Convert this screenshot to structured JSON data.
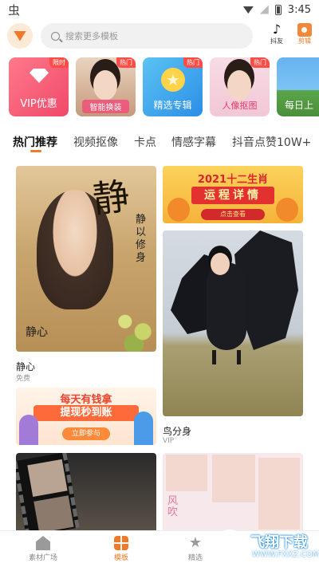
{
  "status_bar": {
    "time": "3:45",
    "left_icon": "bug-icon"
  },
  "search": {
    "placeholder": "搜索更多模板"
  },
  "top_actions": {
    "tiktok_label": "抖友",
    "cut_label": "剪辑"
  },
  "tiles": [
    {
      "label": "VIP优惠",
      "badge": "限时"
    },
    {
      "label": "智能换装",
      "badge": "热门"
    },
    {
      "label": "精选专辑",
      "badge": "热门"
    },
    {
      "label": "人像抠图",
      "badge": "热门"
    },
    {
      "label": "每日上"
    }
  ],
  "tabs": [
    "热门推荐",
    "视频抠像",
    "卡点",
    "情感字幕",
    "抖音点赞10W+"
  ],
  "feed": {
    "jingxin": {
      "title": "静心",
      "subtitle": "免费",
      "calligraphy": "静",
      "poem": "静以修身",
      "signature": "静心"
    },
    "zodiac": {
      "headline": "2021十二生肖",
      "banner": "运程详情",
      "sub": "点击查看"
    },
    "bird": {
      "title": "鸟分身",
      "subtitle": "VIP"
    },
    "ad": {
      "line1": "每天有钱拿",
      "line2": "提现秒到账",
      "button": "立即参与"
    },
    "collage": {
      "text": "风吹"
    }
  },
  "bottom_nav": [
    {
      "label": "素材广场",
      "icon": "home-icon"
    },
    {
      "label": "模板",
      "icon": "template-grid-icon",
      "active": true
    },
    {
      "label": "精选",
      "icon": "star-icon"
    }
  ],
  "watermark": {
    "title": "飞翔下载",
    "url": "WWW.FXXZ.COM"
  },
  "colors": {
    "accent": "#f07a2a",
    "badge": "#ff4d45"
  }
}
